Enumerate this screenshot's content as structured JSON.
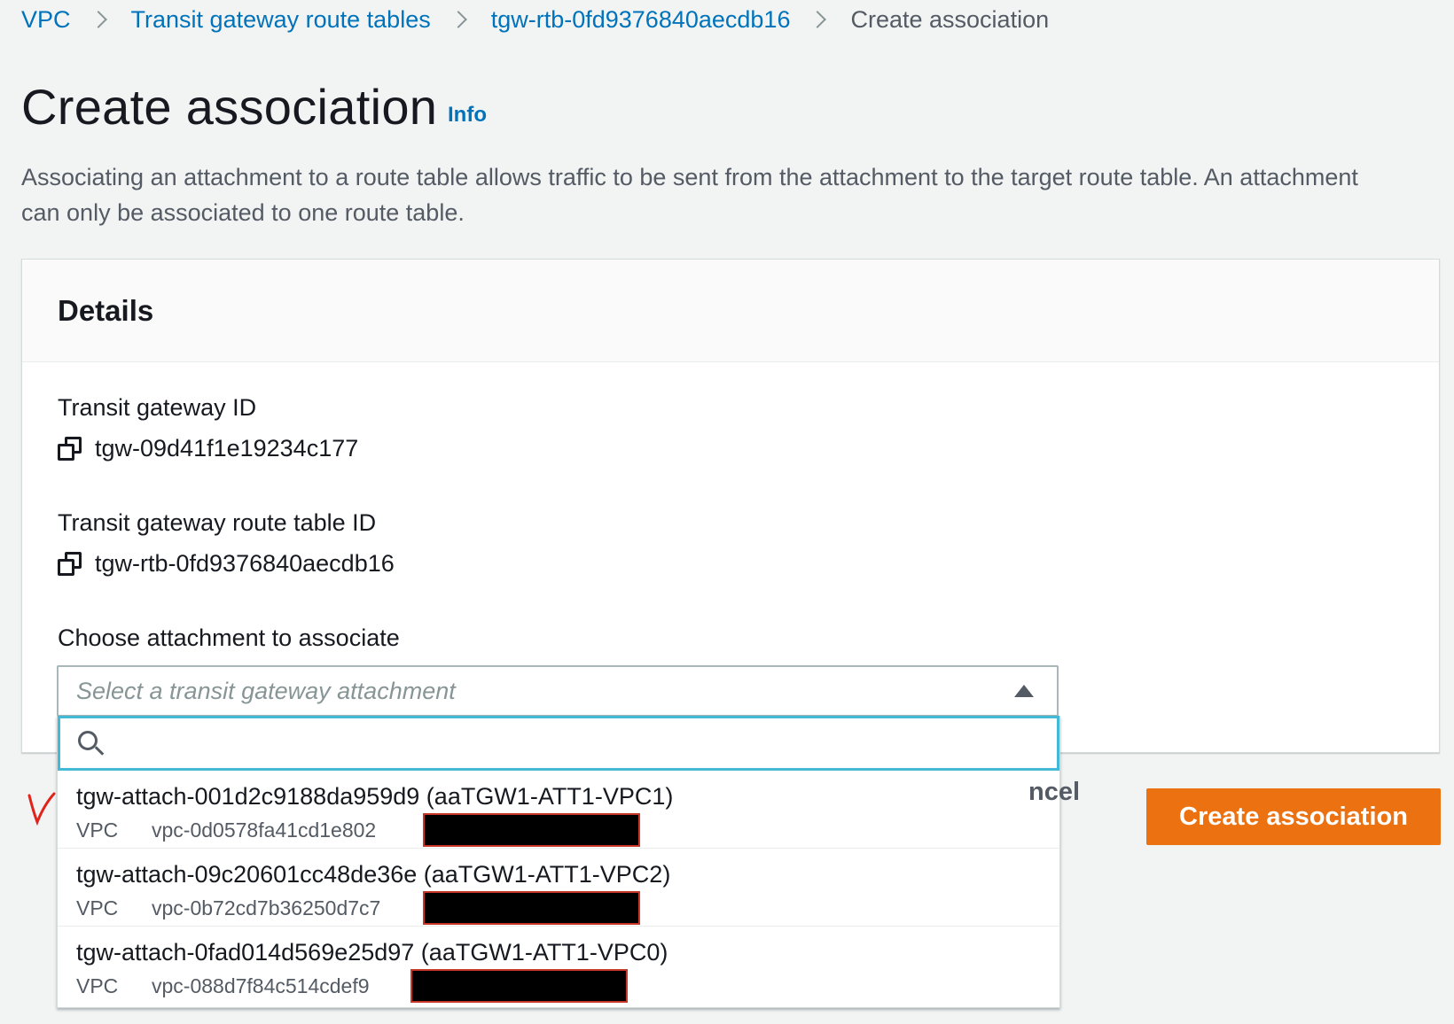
{
  "breadcrumb": {
    "items": [
      {
        "label": "VPC"
      },
      {
        "label": "Transit gateway route tables"
      },
      {
        "label": "tgw-rtb-0fd9376840aecdb16"
      }
    ],
    "current": "Create association"
  },
  "header": {
    "title": "Create association",
    "info_label": "Info",
    "description": "Associating an attachment to a route table allows traffic to be sent from the attachment to the target route table. An attachment can only be associated to one route table."
  },
  "details": {
    "title": "Details",
    "tgw_id_label": "Transit gateway ID",
    "tgw_id_value": "tgw-09d41f1e19234c177",
    "rtb_id_label": "Transit gateway route table ID",
    "rtb_id_value": "tgw-rtb-0fd9376840aecdb16",
    "attachment_label": "Choose attachment to associate",
    "select_placeholder": "Select a transit gateway attachment",
    "search_value": ""
  },
  "dropdown": {
    "options": [
      {
        "title": "tgw-attach-001d2c9188da959d9 (aaTGW1-ATT1-VPC1)",
        "tag": "VPC",
        "vpc": "vpc-0d0578fa41cd1e802"
      },
      {
        "title": "tgw-attach-09c20601cc48de36e (aaTGW1-ATT1-VPC2)",
        "tag": "VPC",
        "vpc": "vpc-0b72cd7b36250d7c7"
      },
      {
        "title": "tgw-attach-0fad014d569e25d97 (aaTGW1-ATT1-VPC0)",
        "tag": "VPC",
        "vpc": "vpc-088d7f84c514cdef9"
      }
    ]
  },
  "footer": {
    "cancel_label": "Cancel",
    "cancel_visible": "ncel",
    "create_label": "Create association"
  },
  "colors": {
    "link": "#0073bb",
    "primary": "#ec7211",
    "focus": "#44b9d6",
    "redaction_border": "#c7382a"
  },
  "icons": [
    "chevron-right-icon",
    "copy-icon",
    "caret-up-icon",
    "search-icon"
  ]
}
